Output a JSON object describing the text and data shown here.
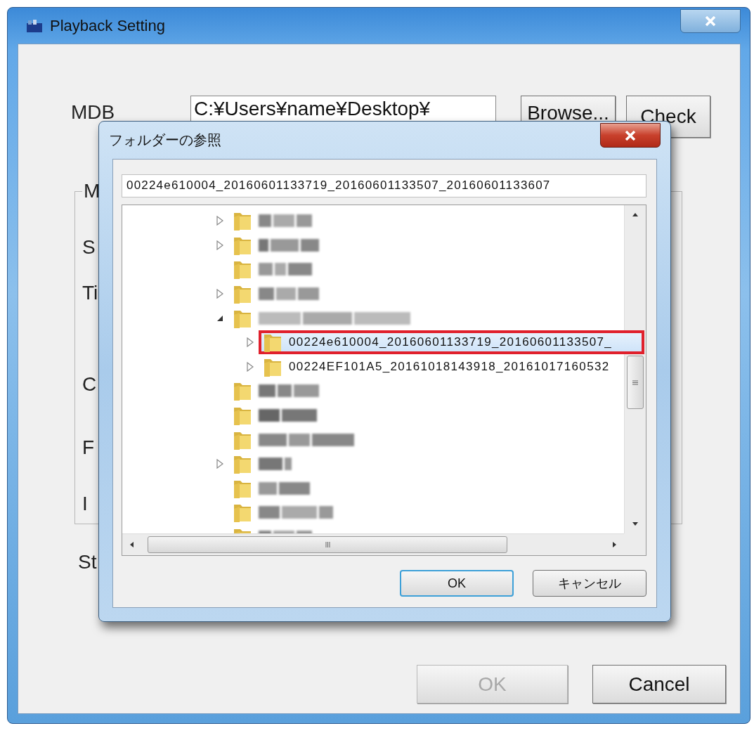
{
  "window": {
    "title": "Playback Setting"
  },
  "mdb": {
    "label": "MDB",
    "value": "C:¥Users¥name¥Desktop¥",
    "buttons": [
      "Browse...",
      "Check"
    ]
  },
  "group_box": {
    "caption": "M",
    "labels": [
      "S",
      "Ti",
      "C",
      "F",
      "I"
    ]
  },
  "status_label": "St",
  "buttons": [
    {
      "label": "OK",
      "disabled": true
    },
    {
      "label": "Cancel",
      "disabled": false
    }
  ],
  "folder_dialog": {
    "title": "フォルダーの参照",
    "path": "00224e610004_20160601133719_20160601133507_20160601133607",
    "tree": [
      {
        "kind": "blurred",
        "expanded": false,
        "selected": false,
        "highlighted": false
      },
      {
        "kind": "blurred",
        "expanded": false,
        "selected": false,
        "highlighted": false
      },
      {
        "kind": "blurred",
        "selected": false,
        "highlighted": false
      },
      {
        "kind": "blurred",
        "expanded": false,
        "selected": false,
        "highlighted": false
      },
      {
        "kind": "blurred",
        "expanded": true,
        "selected": false,
        "highlighted": false,
        "children": [
          {
            "kind": "named",
            "label": "00224e610004_20160601133719_20160601133507_",
            "expanded": false,
            "selected": true,
            "highlighted": true
          },
          {
            "kind": "named",
            "label": "00224EF101A5_20161018143918_20161017160532",
            "expanded": false,
            "selected": false,
            "highlighted": false
          }
        ]
      },
      {
        "kind": "blurred",
        "selected": false,
        "highlighted": false
      },
      {
        "kind": "blurred",
        "selected": false,
        "highlighted": false
      },
      {
        "kind": "blurred",
        "selected": false,
        "highlighted": false
      },
      {
        "kind": "blurred",
        "expanded": false,
        "selected": false,
        "highlighted": false
      },
      {
        "kind": "blurred",
        "selected": false,
        "highlighted": false
      },
      {
        "kind": "blurred",
        "selected": false,
        "highlighted": false
      },
      {
        "kind": "blurred",
        "selected": false,
        "highlighted": false
      }
    ],
    "buttons": [
      {
        "label": "OK",
        "default": true
      },
      {
        "label": "キャンセル",
        "default": false
      }
    ]
  }
}
